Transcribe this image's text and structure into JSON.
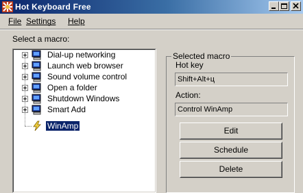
{
  "window": {
    "title": "Hot Keyboard Free"
  },
  "menubar": {
    "items": [
      "File",
      "Settings",
      "Help"
    ]
  },
  "macro_list": {
    "label": "Select a macro:",
    "items": [
      {
        "label": "Dial-up networking",
        "icon": "computer-icon",
        "expandable": true
      },
      {
        "label": "Launch web browser",
        "icon": "computer-icon",
        "expandable": true
      },
      {
        "label": "Sound volume control",
        "icon": "computer-icon",
        "expandable": true
      },
      {
        "label": "Open a folder",
        "icon": "computer-icon",
        "expandable": true
      },
      {
        "label": "Shutdown Windows",
        "icon": "computer-icon",
        "expandable": true
      },
      {
        "label": "Smart Add",
        "icon": "computer-icon",
        "expandable": true
      },
      {
        "label": "WinAmp",
        "icon": "lightning-icon",
        "expandable": false,
        "selected": true
      }
    ]
  },
  "selected_macro": {
    "title": "Selected macro",
    "hotkey_label": "Hot key",
    "hotkey_value": "Shift+Alt+ц",
    "action_label": "Action:",
    "action_value": "Control WinAmp",
    "buttons": {
      "edit": "Edit",
      "schedule": "Schedule",
      "delete": "Delete"
    }
  },
  "colors": {
    "title_bar": "#0a246a",
    "window_face": "#d4d0c8",
    "selection": "#0a246a"
  }
}
